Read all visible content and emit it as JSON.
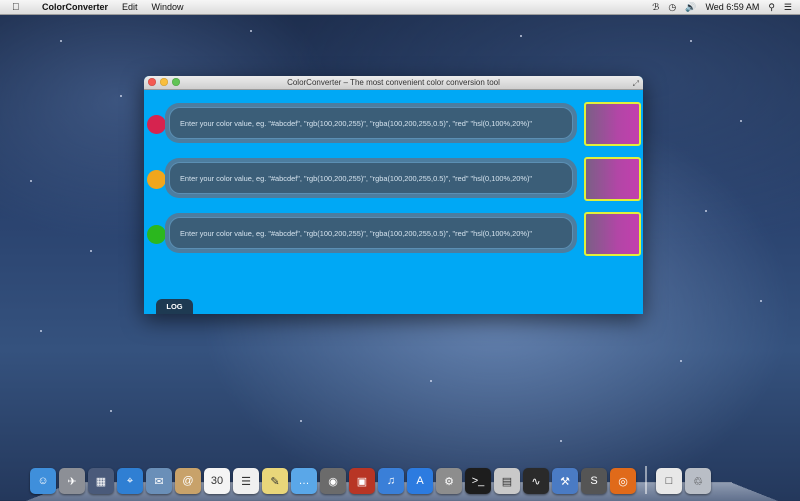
{
  "menubar": {
    "app_name": "ColorConverter",
    "menus": [
      "Edit",
      "Window"
    ],
    "clock": "Wed 6:59 AM",
    "status_icons": [
      "bluetooth-icon",
      "time-machine-icon",
      "volume-icon",
      "search-icon",
      "list-icon"
    ]
  },
  "window": {
    "title": "ColorConverter – The most convenient color conversion tool",
    "placeholder": "Enter your color value, eg. \"#abcdef\", \"rgb(100,200,255)\", \"rgba(100,200,255,0.5)\", \"red\" \"hsl(0,100%,20%)\"",
    "rows": [
      {
        "dot_color": "#d6234f"
      },
      {
        "dot_color": "#f1a61c"
      },
      {
        "dot_color": "#2bb71e"
      }
    ],
    "log_tab": "LOG"
  },
  "dock": {
    "icons": [
      {
        "name": "finder-icon",
        "color": "#3f8fdb",
        "glyph": "☺"
      },
      {
        "name": "launchpad-icon",
        "color": "#8c8f96",
        "glyph": "✈"
      },
      {
        "name": "mission-control-icon",
        "color": "#4a5a7a",
        "glyph": "▦"
      },
      {
        "name": "safari-icon",
        "color": "#2f7fd3",
        "glyph": "⌖"
      },
      {
        "name": "mail-icon",
        "color": "#6a8fb8",
        "glyph": "✉"
      },
      {
        "name": "contacts-icon",
        "color": "#c8a26a",
        "glyph": "@"
      },
      {
        "name": "calendar-icon",
        "color": "#f4f4f4",
        "glyph": "30"
      },
      {
        "name": "reminders-icon",
        "color": "#f0f0f0",
        "glyph": "☰"
      },
      {
        "name": "notes-icon",
        "color": "#e9d67a",
        "glyph": "✎"
      },
      {
        "name": "messages-icon",
        "color": "#5aa7e8",
        "glyph": "…"
      },
      {
        "name": "facetime-icon",
        "color": "#6b6b6b",
        "glyph": "◉"
      },
      {
        "name": "photo-booth-icon",
        "color": "#b83525",
        "glyph": "▣"
      },
      {
        "name": "itunes-icon",
        "color": "#3a7fd8",
        "glyph": "♫"
      },
      {
        "name": "app-store-icon",
        "color": "#2c7be0",
        "glyph": "A"
      },
      {
        "name": "system-preferences-icon",
        "color": "#8d8d8d",
        "glyph": "⚙"
      },
      {
        "name": "terminal-icon",
        "color": "#1d1d1d",
        "glyph": ">_"
      },
      {
        "name": "preview-icon",
        "color": "#c9c9c9",
        "glyph": "▤"
      },
      {
        "name": "activity-monitor-icon",
        "color": "#2a2a2a",
        "glyph": "∿"
      },
      {
        "name": "xcode-icon",
        "color": "#4a7bc4",
        "glyph": "⚒"
      },
      {
        "name": "sublime-icon",
        "color": "#555555",
        "glyph": "S"
      },
      {
        "name": "colorconverter-icon",
        "color": "#e06a1a",
        "glyph": "◎"
      }
    ],
    "right_icons": [
      {
        "name": "documents-stack-icon",
        "color": "#e8e8e8",
        "glyph": "□"
      },
      {
        "name": "trash-icon",
        "color": "#b9bec6",
        "glyph": "♲"
      }
    ]
  }
}
